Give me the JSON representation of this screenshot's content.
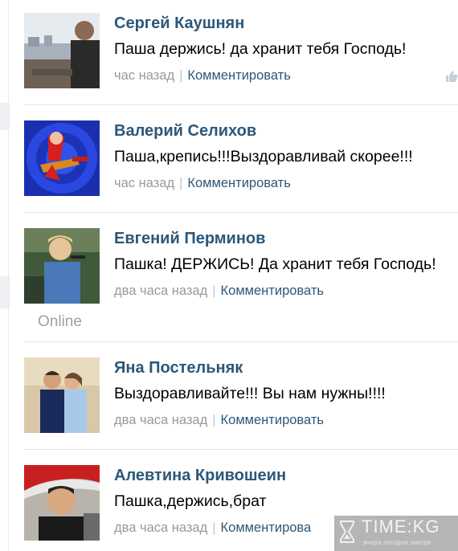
{
  "comments": [
    {
      "author": "Сергей Каушнян",
      "text": "Паша держись! да хранит тебя Господь!",
      "time": "час назад",
      "reply": "Комментировать"
    },
    {
      "author": "Валерий Селихов",
      "text": "Паша,крепись!!!Выздоравливай скорее!!!",
      "time": "час назад",
      "reply": "Комментировать"
    },
    {
      "author": "Евгений Перминов",
      "text": "Пашка! ДЕРЖИСЬ! Да хранит тебя Господь!",
      "time": "два часа назад",
      "reply": "Комментировать",
      "status": "Online"
    },
    {
      "author": "Яна Постельняк",
      "text": "Выздоравливайте!!! Вы нам нужны!!!!",
      "time": "два часа назад",
      "reply": "Комментировать"
    },
    {
      "author": "Алевтина Кривошеин",
      "text": "Пашка,держись,брат",
      "time": "два часа назад",
      "reply": "Комментирова"
    }
  ],
  "watermark": {
    "title": "TIME:KG",
    "subtitle": "вчера сегодня завтра"
  },
  "colors": {
    "link": "#2b587a",
    "meta": "#999999",
    "divider": "#e3e6ea"
  }
}
